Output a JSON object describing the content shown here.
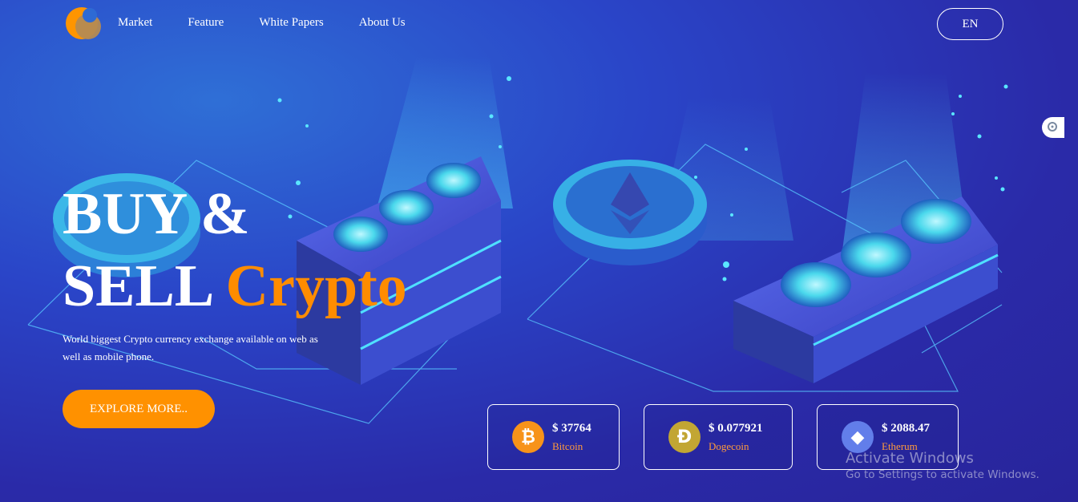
{
  "nav": {
    "items": [
      {
        "label": "Market"
      },
      {
        "label": "Feature"
      },
      {
        "label": "White Papers"
      },
      {
        "label": "About Us"
      }
    ],
    "lang": "EN"
  },
  "hero": {
    "line1": "BUY &",
    "line2": "SELL",
    "accent": "Crypto",
    "subtitle": "World biggest Crypto currency exchange available on web as well as mobile phone.",
    "cta": "EXPLORE MORE.."
  },
  "prices": [
    {
      "price": "$ 37764",
      "name": "Bitcoin",
      "icon": "bitcoin-icon",
      "color": "#f7931a",
      "glyph": "₿"
    },
    {
      "price": "$ 0.077921",
      "name": "Dogecoin",
      "icon": "dogecoin-icon",
      "color": "#c2a633",
      "glyph": "Ð"
    },
    {
      "price": "$ 2088.47",
      "name": "Etherum",
      "icon": "ethereum-icon",
      "color": "#627eea",
      "glyph": "◆"
    }
  ],
  "watermark": {
    "title": "Activate Windows",
    "subtitle": "Go to Settings to activate Windows."
  },
  "colors": {
    "accent": "#ff8c00",
    "background": "#2a2aa8",
    "glow": "#3ee0f0"
  }
}
